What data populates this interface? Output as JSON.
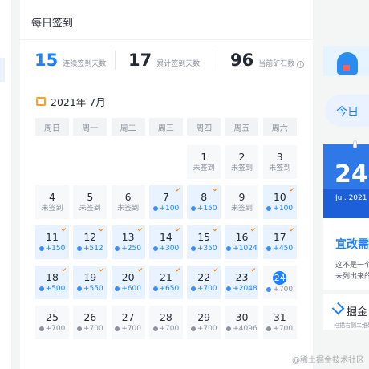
{
  "header": {
    "title": "每日签到"
  },
  "stats": [
    {
      "value": "15",
      "label": "连续签到天数"
    },
    {
      "value": "17",
      "label": "累计签到天数"
    },
    {
      "value": "96",
      "label": "当前矿石数"
    }
  ],
  "calendar": {
    "month_label": "2021年 7月",
    "weekdays": [
      "周日",
      "周一",
      "周二",
      "周三",
      "周四",
      "周五",
      "周六"
    ],
    "leading_empty": 4,
    "days": [
      {
        "day": "1",
        "status": "未签到",
        "state": "missed"
      },
      {
        "day": "2",
        "status": "未签到",
        "state": "missed"
      },
      {
        "day": "3",
        "status": "未签到",
        "state": "missed"
      },
      {
        "day": "4",
        "status": "未签到",
        "state": "missed"
      },
      {
        "day": "5",
        "status": "未签到",
        "state": "missed"
      },
      {
        "day": "6",
        "status": "未签到",
        "state": "missed"
      },
      {
        "day": "7",
        "status": "+100",
        "state": "signed"
      },
      {
        "day": "8",
        "status": "+150",
        "state": "signed"
      },
      {
        "day": "9",
        "status": "未签到",
        "state": "missed"
      },
      {
        "day": "10",
        "status": "+100",
        "state": "signed"
      },
      {
        "day": "11",
        "status": "+150",
        "state": "signed"
      },
      {
        "day": "12",
        "status": "+512",
        "state": "signed"
      },
      {
        "day": "13",
        "status": "+250",
        "state": "signed"
      },
      {
        "day": "14",
        "status": "+300",
        "state": "signed"
      },
      {
        "day": "15",
        "status": "+350",
        "state": "signed"
      },
      {
        "day": "16",
        "status": "+1024",
        "state": "signed"
      },
      {
        "day": "17",
        "status": "+450",
        "state": "signed"
      },
      {
        "day": "18",
        "status": "+500",
        "state": "signed"
      },
      {
        "day": "19",
        "status": "+550",
        "state": "signed"
      },
      {
        "day": "20",
        "status": "+600",
        "state": "signed"
      },
      {
        "day": "21",
        "status": "+650",
        "state": "signed"
      },
      {
        "day": "22",
        "status": "+700",
        "state": "signed"
      },
      {
        "day": "23",
        "status": "+2048",
        "state": "signed"
      },
      {
        "day": "24",
        "status": "+700",
        "state": "today"
      },
      {
        "day": "25",
        "status": "+700",
        "state": "future"
      },
      {
        "day": "26",
        "status": "+700",
        "state": "future"
      },
      {
        "day": "27",
        "status": "+700",
        "state": "future"
      },
      {
        "day": "28",
        "status": "+700",
        "state": "future"
      },
      {
        "day": "29",
        "status": "+700",
        "state": "future"
      },
      {
        "day": "30",
        "status": "+4096",
        "state": "future"
      },
      {
        "day": "31",
        "status": "+700",
        "state": "future"
      }
    ]
  },
  "side": {
    "cta_label": "今日",
    "date_big": "24",
    "date_sub": "Jul. 2021",
    "quote_title": "宜改需",
    "quote_lines": [
      "这不是一个",
      "未列出来的"
    ],
    "brand_name": "掘金",
    "brand_tip": "扫描右侧二维码"
  },
  "watermark": "@稀土掘金技术社区",
  "colors": {
    "accent": "#1e80ff",
    "signed_bg": "#e8f3ff",
    "check": "#ff7d00"
  }
}
